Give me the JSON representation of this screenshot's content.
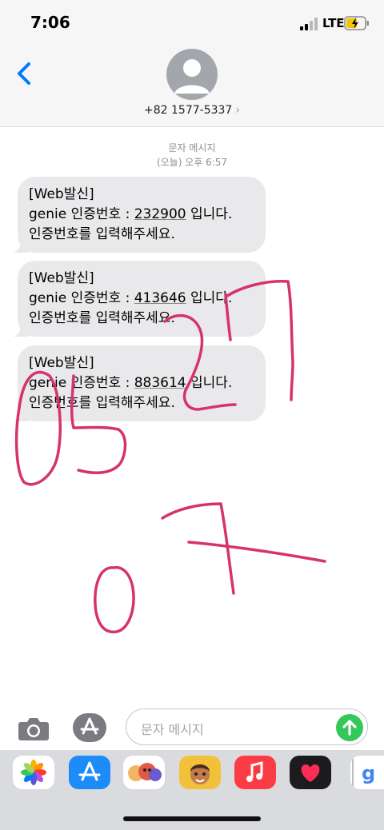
{
  "status_bar": {
    "time": "7:06",
    "network": "LTE"
  },
  "header": {
    "contact": "+82 1577-5337",
    "chevron": "›"
  },
  "thread": {
    "label": "문자 메시지",
    "timestamp": "(오늘) 오후 6:57",
    "messages": [
      {
        "line1": "[Web발신]",
        "line2_pre": "genie 인증번호 : ",
        "code": "232900",
        "line2_post": " 입니다.",
        "line3": "인증번호를 입력해주세요."
      },
      {
        "line1": "[Web발신]",
        "line2_pre": "genie 인증번호 : ",
        "code": "413646",
        "line2_post": " 입니다.",
        "line3": "인증번호를 입력해주세요."
      },
      {
        "line1": "[Web발신]",
        "line2_pre": "genie 인증번호 : ",
        "code": "883614",
        "line2_post": " 입니다.",
        "line3": "인증번호를 입력해주세요."
      }
    ]
  },
  "compose": {
    "placeholder": "문자 메시지"
  },
  "icons": {
    "back": "chevron-left-icon",
    "camera": "camera-icon",
    "appstore": "app-store-icon",
    "send": "send-arrow-icon"
  },
  "drawer_apps": [
    "photos",
    "app-store",
    "memoji-stickers",
    "memoji",
    "music",
    "digital-touch",
    "gif-search"
  ],
  "colors": {
    "accent": "#007aff",
    "bubble": "#e9e9eb",
    "send": "#34c759",
    "scribble": "#d6336c"
  }
}
